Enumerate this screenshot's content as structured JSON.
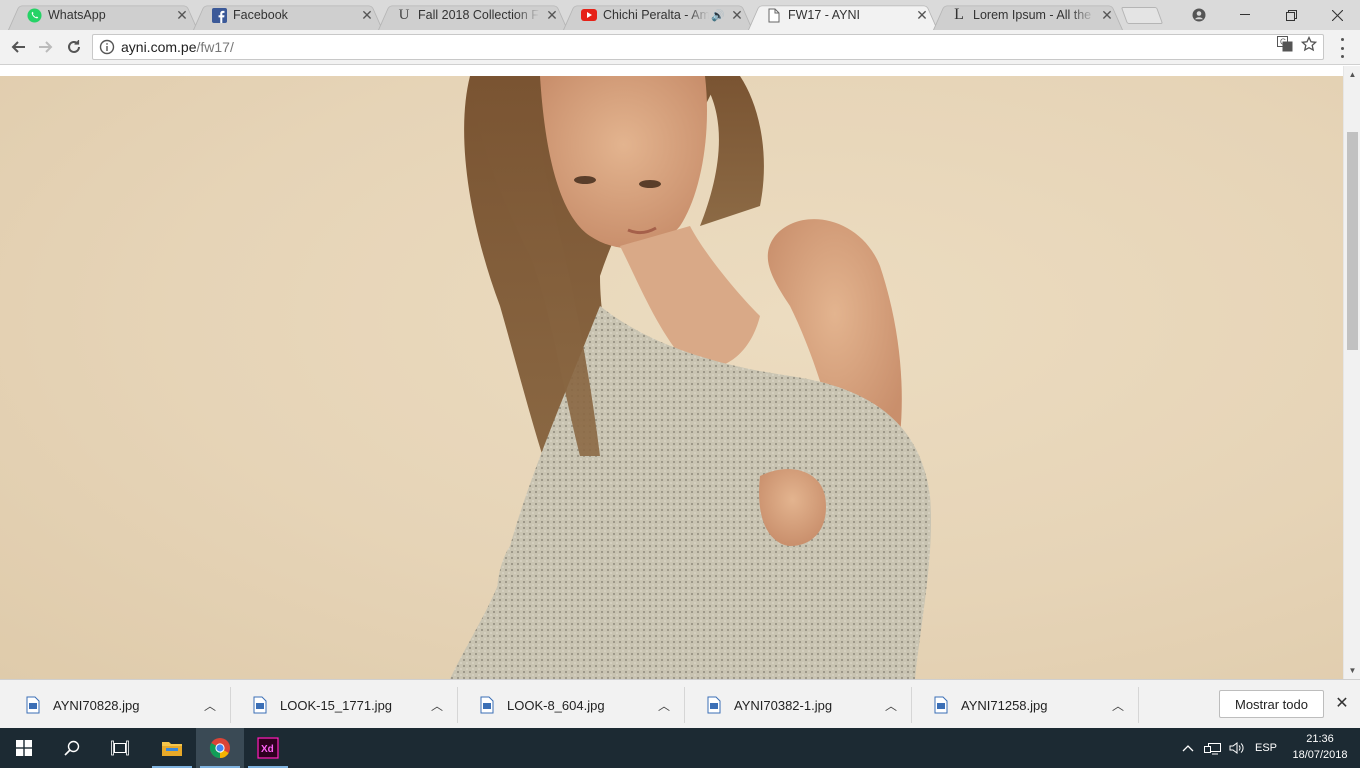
{
  "tabs": [
    {
      "title": "WhatsApp",
      "icon": "whatsapp-icon",
      "active": false
    },
    {
      "title": "Facebook",
      "icon": "facebook-icon",
      "active": false
    },
    {
      "title": "Fall 2018 Collection Free",
      "icon": "unsplash-icon",
      "active": false
    },
    {
      "title": "Chichi Peralta - Amor",
      "icon": "youtube-icon",
      "active": false,
      "audio": true
    },
    {
      "title": "FW17 - AYNI",
      "icon": "document-icon",
      "active": true
    },
    {
      "title": "Lorem Ipsum - All the fa",
      "icon": "lipsum-icon",
      "active": false
    }
  ],
  "address": {
    "host": "ayni.com.pe",
    "path": "/fw17/"
  },
  "downloads": [
    {
      "name": "AYNI70828.jpg"
    },
    {
      "name": "LOOK-15_1771.jpg"
    },
    {
      "name": "LOOK-8_604.jpg"
    },
    {
      "name": "AYNI70382-1.jpg"
    },
    {
      "name": "AYNI71258.jpg"
    }
  ],
  "shelf": {
    "show_all_label": "Mostrar todo"
  },
  "taskbar": {
    "language": "ESP",
    "time": "21:36",
    "date": "18/07/2018"
  },
  "colors": {
    "hero_background": "#e6d4b7",
    "taskbar": "#1c2a33",
    "sweater": "#cbc6b4"
  }
}
